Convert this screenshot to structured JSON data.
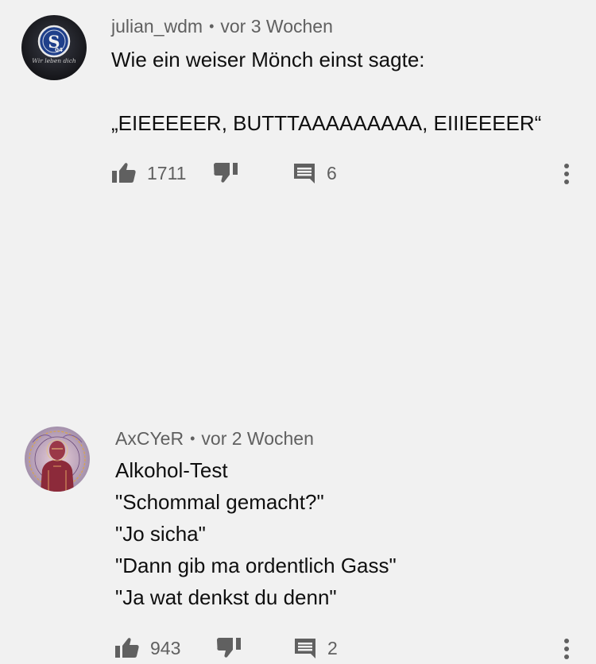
{
  "comments": [
    {
      "author": "julian_wdm",
      "separator": "•",
      "time": "vor 3 Wochen",
      "text": "Wie ein weiser Mönch einst sagte:\n\n„EIEEEEER, BUTTTAAAAAAAAA, EIIIEEEER“",
      "likes": "1711",
      "replies": "6",
      "avatar_text": "Wir leben dich",
      "avatar_badge": "04",
      "avatar_bg": "#1d1d20",
      "icons": {
        "like": "thumb-up-icon",
        "dislike": "thumb-down-icon",
        "reply": "comment-icon",
        "more": "more-vert-icon"
      }
    },
    {
      "author": "AxCYeR",
      "separator": "•",
      "time": "vor 2 Wochen",
      "text": "Alkohol-Test\n\"Schommal gemacht?\"\n\"Jo sicha\"\n\"Dann gib ma ordentlich Gass\"\n\"Ja wat denkst du denn\"",
      "likes": "943",
      "replies": "2",
      "avatar_bg": "#c5a6b3",
      "icons": {
        "like": "thumb-up-icon",
        "dislike": "thumb-down-icon",
        "reply": "comment-icon",
        "more": "more-vert-icon"
      }
    }
  ],
  "colors": {
    "background": "#f1f1f1",
    "text": "#0f0f0f",
    "secondary_text": "#606060",
    "icon": "#606060"
  }
}
